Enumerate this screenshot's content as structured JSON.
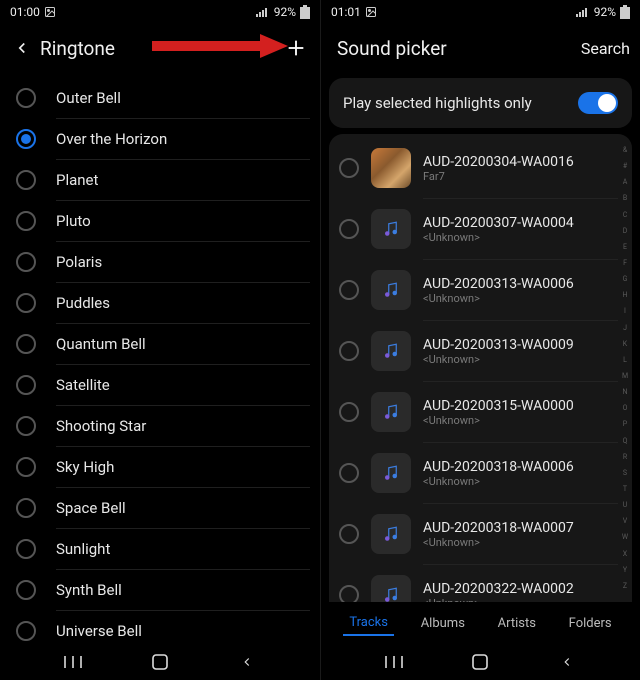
{
  "left": {
    "status": {
      "time": "01:00",
      "battery": "92%"
    },
    "title": "Ringtone",
    "items": [
      {
        "label": "Outer Bell",
        "selected": false
      },
      {
        "label": "Over the Horizon",
        "selected": true
      },
      {
        "label": "Planet",
        "selected": false
      },
      {
        "label": "Pluto",
        "selected": false
      },
      {
        "label": "Polaris",
        "selected": false
      },
      {
        "label": "Puddles",
        "selected": false
      },
      {
        "label": "Quantum Bell",
        "selected": false
      },
      {
        "label": "Satellite",
        "selected": false
      },
      {
        "label": "Shooting Star",
        "selected": false
      },
      {
        "label": "Sky High",
        "selected": false
      },
      {
        "label": "Space Bell",
        "selected": false
      },
      {
        "label": "Sunlight",
        "selected": false
      },
      {
        "label": "Synth Bell",
        "selected": false
      },
      {
        "label": "Universe Bell",
        "selected": false
      }
    ]
  },
  "right": {
    "status": {
      "time": "01:01",
      "battery": "92%"
    },
    "title": "Sound picker",
    "search_label": "Search",
    "highlights_label": "Play selected highlights only",
    "highlights_on": true,
    "tracks": [
      {
        "name": "AUD-20200304-WA0016",
        "artist": "Far7",
        "art": true
      },
      {
        "name": "AUD-20200307-WA0004",
        "artist": "<Unknown>",
        "art": false
      },
      {
        "name": "AUD-20200313-WA0006",
        "artist": "<Unknown>",
        "art": false
      },
      {
        "name": "AUD-20200313-WA0009",
        "artist": "<Unknown>",
        "art": false
      },
      {
        "name": "AUD-20200315-WA0000",
        "artist": "<Unknown>",
        "art": false
      },
      {
        "name": "AUD-20200318-WA0006",
        "artist": "<Unknown>",
        "art": false
      },
      {
        "name": "AUD-20200318-WA0007",
        "artist": "<Unknown>",
        "art": false
      },
      {
        "name": "AUD-20200322-WA0002",
        "artist": "<Unknown>",
        "art": false
      }
    ],
    "index_letters": [
      "&",
      "#",
      "A",
      "B",
      "C",
      "D",
      "E",
      "F",
      "G",
      "H",
      "I",
      "J",
      "K",
      "L",
      "M",
      "N",
      "O",
      "P",
      "Q",
      "R",
      "S",
      "T",
      "U",
      "V",
      "W",
      "X",
      "Y",
      "Z"
    ],
    "tabs": [
      {
        "label": "Tracks",
        "active": true
      },
      {
        "label": "Albums",
        "active": false
      },
      {
        "label": "Artists",
        "active": false
      },
      {
        "label": "Folders",
        "active": false
      }
    ]
  },
  "arrow_color": "#d3201f"
}
